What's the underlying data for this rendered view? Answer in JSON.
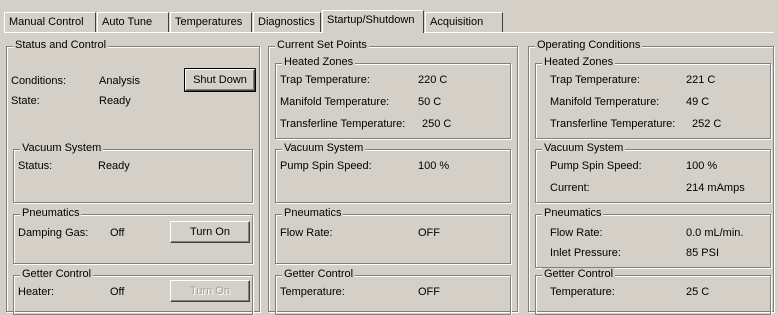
{
  "tabs": [
    "Manual Control",
    "Auto Tune",
    "Temperatures",
    "Diagnostics",
    "Startup/Shutdown",
    "Acquisition"
  ],
  "status_control": {
    "title": "Status and Control",
    "conditions_label": "Conditions:",
    "conditions_value": "Analysis",
    "state_label": "State:",
    "state_value": "Ready",
    "shutdown_button": "Shut Down",
    "vacuum": {
      "title": "Vacuum System",
      "status_label": "Status:",
      "status_value": "Ready"
    },
    "pneumatics": {
      "title": "Pneumatics",
      "damping_label": "Damping Gas:",
      "damping_value": "Off",
      "button": "Turn On"
    },
    "getter": {
      "title": "Getter Control",
      "heater_label": "Heater:",
      "heater_value": "Off",
      "button": "Turn On"
    }
  },
  "set_points": {
    "title": "Current Set Points",
    "heated": {
      "title": "Heated Zones",
      "trap_label": "Trap Temperature:",
      "trap_value": "220 C",
      "manifold_label": "Manifold Temperature:",
      "manifold_value": "50 C",
      "transfer_label": "Transferline Temperature:",
      "transfer_value": "250 C"
    },
    "vacuum": {
      "title": "Vacuum System",
      "pump_label": "Pump Spin Speed:",
      "pump_value": "100 %"
    },
    "pneumatics": {
      "title": "Pneumatics",
      "flow_label": "Flow Rate:",
      "flow_value": "OFF"
    },
    "getter": {
      "title": "Getter Control",
      "temp_label": "Temperature:",
      "temp_value": "OFF"
    }
  },
  "operating": {
    "title": "Operating Conditions",
    "heated": {
      "title": "Heated Zones",
      "trap_label": "Trap Temperature:",
      "trap_value": "221 C",
      "manifold_label": "Manifold Temperature:",
      "manifold_value": "49 C",
      "transfer_label": "Transferline Temperature:",
      "transfer_value": "252 C"
    },
    "vacuum": {
      "title": "Vacuum System",
      "pump_label": "Pump Spin Speed:",
      "pump_value": "100 %",
      "current_label": "Current:",
      "current_value": "214 mAmps"
    },
    "pneumatics": {
      "title": "Pneumatics",
      "flow_label": "Flow Rate:",
      "flow_value": "0.0 mL/min.",
      "inlet_label": "Inlet Pressure:",
      "inlet_value": "85 PSI"
    },
    "getter": {
      "title": "Getter Control",
      "temp_label": "Temperature:",
      "temp_value": "25 C"
    }
  }
}
